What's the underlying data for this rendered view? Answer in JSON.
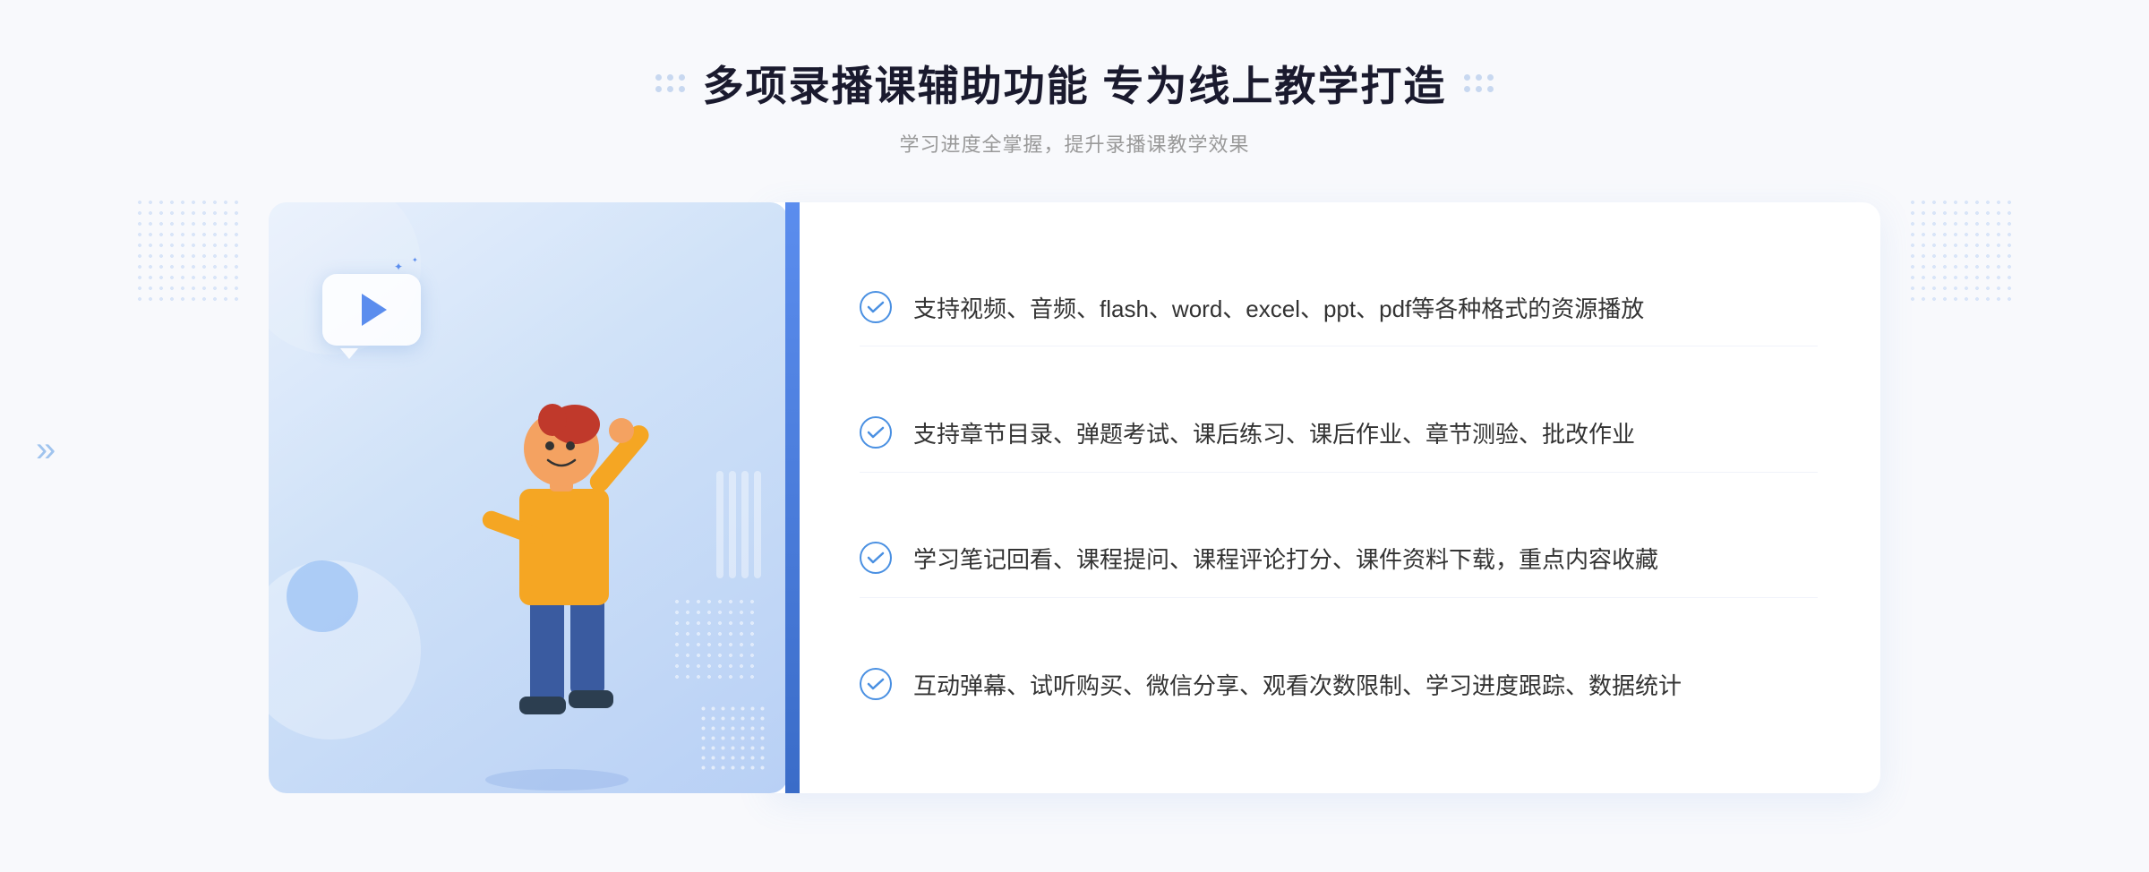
{
  "header": {
    "title": "多项录播课辅助功能 专为线上教学打造",
    "subtitle": "学习进度全掌握，提升录播课教学效果"
  },
  "features": [
    {
      "id": "feature-1",
      "text": "支持视频、音频、flash、word、excel、ppt、pdf等各种格式的资源播放"
    },
    {
      "id": "feature-2",
      "text": "支持章节目录、弹题考试、课后练习、课后作业、章节测验、批改作业"
    },
    {
      "id": "feature-3",
      "text": "学习笔记回看、课程提问、课程评论打分、课件资料下载，重点内容收藏"
    },
    {
      "id": "feature-4",
      "text": "互动弹幕、试听购买、微信分享、观看次数限制、学习进度跟踪、数据统计"
    }
  ],
  "decoration": {
    "play_button": "▶",
    "left_arrow": "»",
    "check_symbol": "✓"
  }
}
